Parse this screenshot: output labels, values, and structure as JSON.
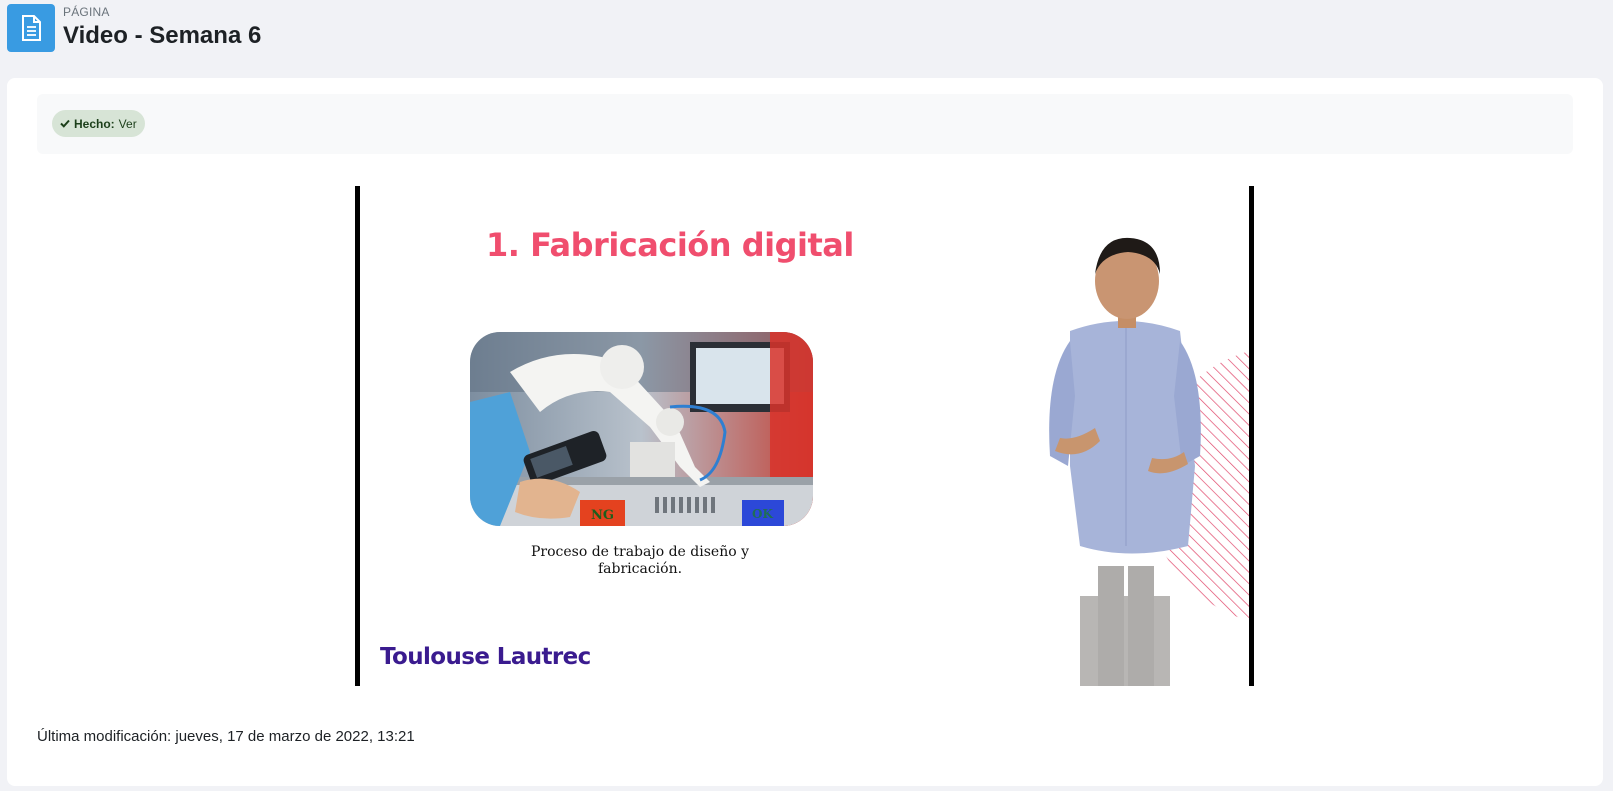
{
  "header": {
    "kicker": "PÁGINA",
    "title": "Video - Semana 6",
    "icon": "page-document-icon",
    "accent": "#399be2"
  },
  "completion": {
    "label": "Hecho:",
    "value": "Ver",
    "icon": "check-icon",
    "color": "#d7e4d6"
  },
  "video": {
    "slide_title": "1. Fabricación digital",
    "caption_line1": "Proceso de trabajo de diseño y",
    "caption_line2": "fabricación.",
    "brand": "Toulouse Lautrec",
    "bin_left": "NG",
    "bin_right": "OK",
    "title_color": "#f04e6e",
    "brand_color": "#3a1b8f"
  },
  "footer": {
    "last_modified": "Última modificación: jueves, 17 de marzo de 2022, 13:21"
  }
}
